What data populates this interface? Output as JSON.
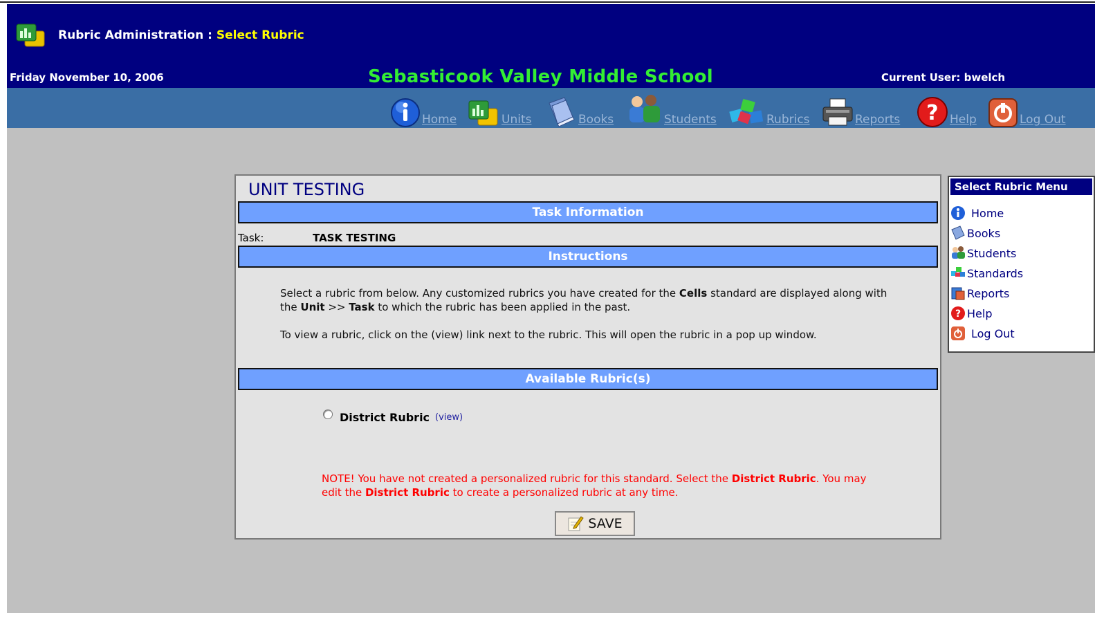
{
  "header": {
    "title_prefix": "Rubric Administration : ",
    "title_highlight": "Select Rubric",
    "date": "Friday November 10, 2006",
    "school": "Sebasticook Valley Middle School",
    "current_user": "Current User: bwelch"
  },
  "nav": {
    "home": "Home",
    "units": "Units",
    "books": "Books",
    "students": "Students",
    "rubrics": "Rubrics",
    "reports": "Reports",
    "help": "Help",
    "logout": "Log Out"
  },
  "panel": {
    "unit_title": "UNIT TESTING",
    "task_info_header": "Task Information",
    "task_label": "Task:",
    "task_value": "TASK TESTING",
    "instructions_header": "Instructions",
    "instr1_a": "Select a rubric from below. Any customized rubrics you have created for the ",
    "instr1_cells": "Cells",
    "instr1_b": " standard are displayed along with the ",
    "instr1_unit": "Unit",
    "instr1_c": " >> ",
    "instr1_task": "Task",
    "instr1_d": " to which the rubric has been applied in the past.",
    "instr2": "To view a rubric, click on the (view) link next to the rubric. This will open the rubric in a pop up window.",
    "available_header": "Available Rubric(s)",
    "rubric_name": "District Rubric",
    "view_link": "(view)",
    "note_a": "NOTE! You have not created a personalized rubric for this standard. Select the ",
    "note_b": "District Rubric",
    "note_c": ". You may edit the ",
    "note_d": "District Rubric",
    "note_e": " to create a personalized rubric at any time.",
    "save_label": "SAVE"
  },
  "side_menu": {
    "title": "Select Rubric Menu",
    "items": [
      "Home",
      "Books",
      "Students",
      "Standards",
      "Reports",
      "Help",
      "Log Out"
    ]
  },
  "colors": {
    "topbar": "#000080",
    "navbar": "#3a6ea5",
    "section_bar": "#6fa0ff",
    "school_name": "#33ee33",
    "note": "#ff0000"
  }
}
